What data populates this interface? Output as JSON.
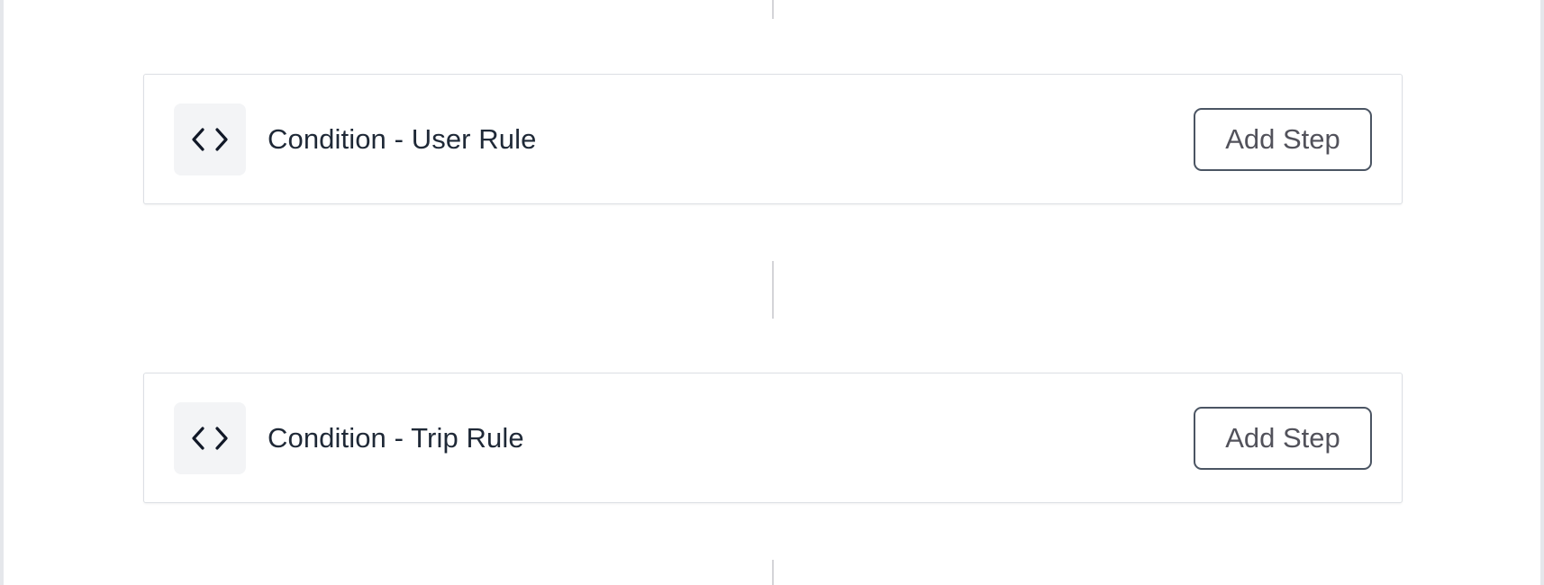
{
  "steps": [
    {
      "icon": "code-brackets-icon",
      "title": "Condition - User Rule",
      "action_label": "Add Step"
    },
    {
      "icon": "code-brackets-icon",
      "title": "Condition - Trip Rule",
      "action_label": "Add Step"
    }
  ],
  "colors": {
    "card_border": "#dcdfe4",
    "icon_background": "#f3f4f6",
    "title_text": "#1f2937",
    "button_border": "#4b5563",
    "button_text": "#52525b",
    "connector": "#d4d4d8"
  }
}
